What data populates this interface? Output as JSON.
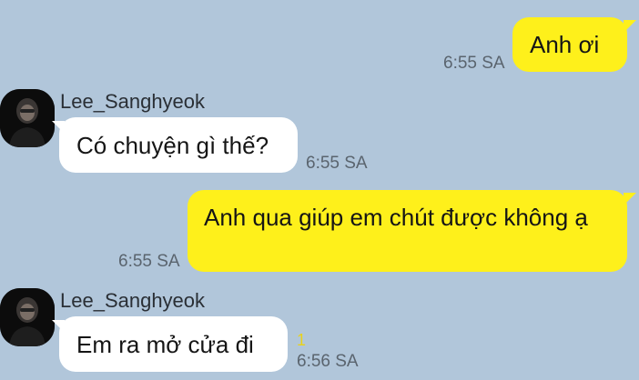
{
  "messages": [
    {
      "id": 1,
      "direction": "out",
      "text": "Anh ơi",
      "time": "6:55 SA"
    },
    {
      "id": 2,
      "direction": "in",
      "sender": "Lee_Sanghyeok",
      "text": "Có chuyện gì thế?",
      "time": "6:55 SA"
    },
    {
      "id": 3,
      "direction": "out",
      "text": "Anh qua giúp em chút được không ạ",
      "time": "6:55 SA"
    },
    {
      "id": 4,
      "direction": "in",
      "sender": "Lee_Sanghyeok",
      "text": "Em ra mở cửa đi",
      "time": "6:56 SA",
      "unread_count": "1"
    }
  ],
  "colors": {
    "background": "#b1c6da",
    "outgoing_bubble": "#fef01b",
    "incoming_bubble": "#ffffff",
    "unread_indicator": "#e9d21b"
  },
  "icons": {
    "avatar": "profile-photo-avatar"
  }
}
